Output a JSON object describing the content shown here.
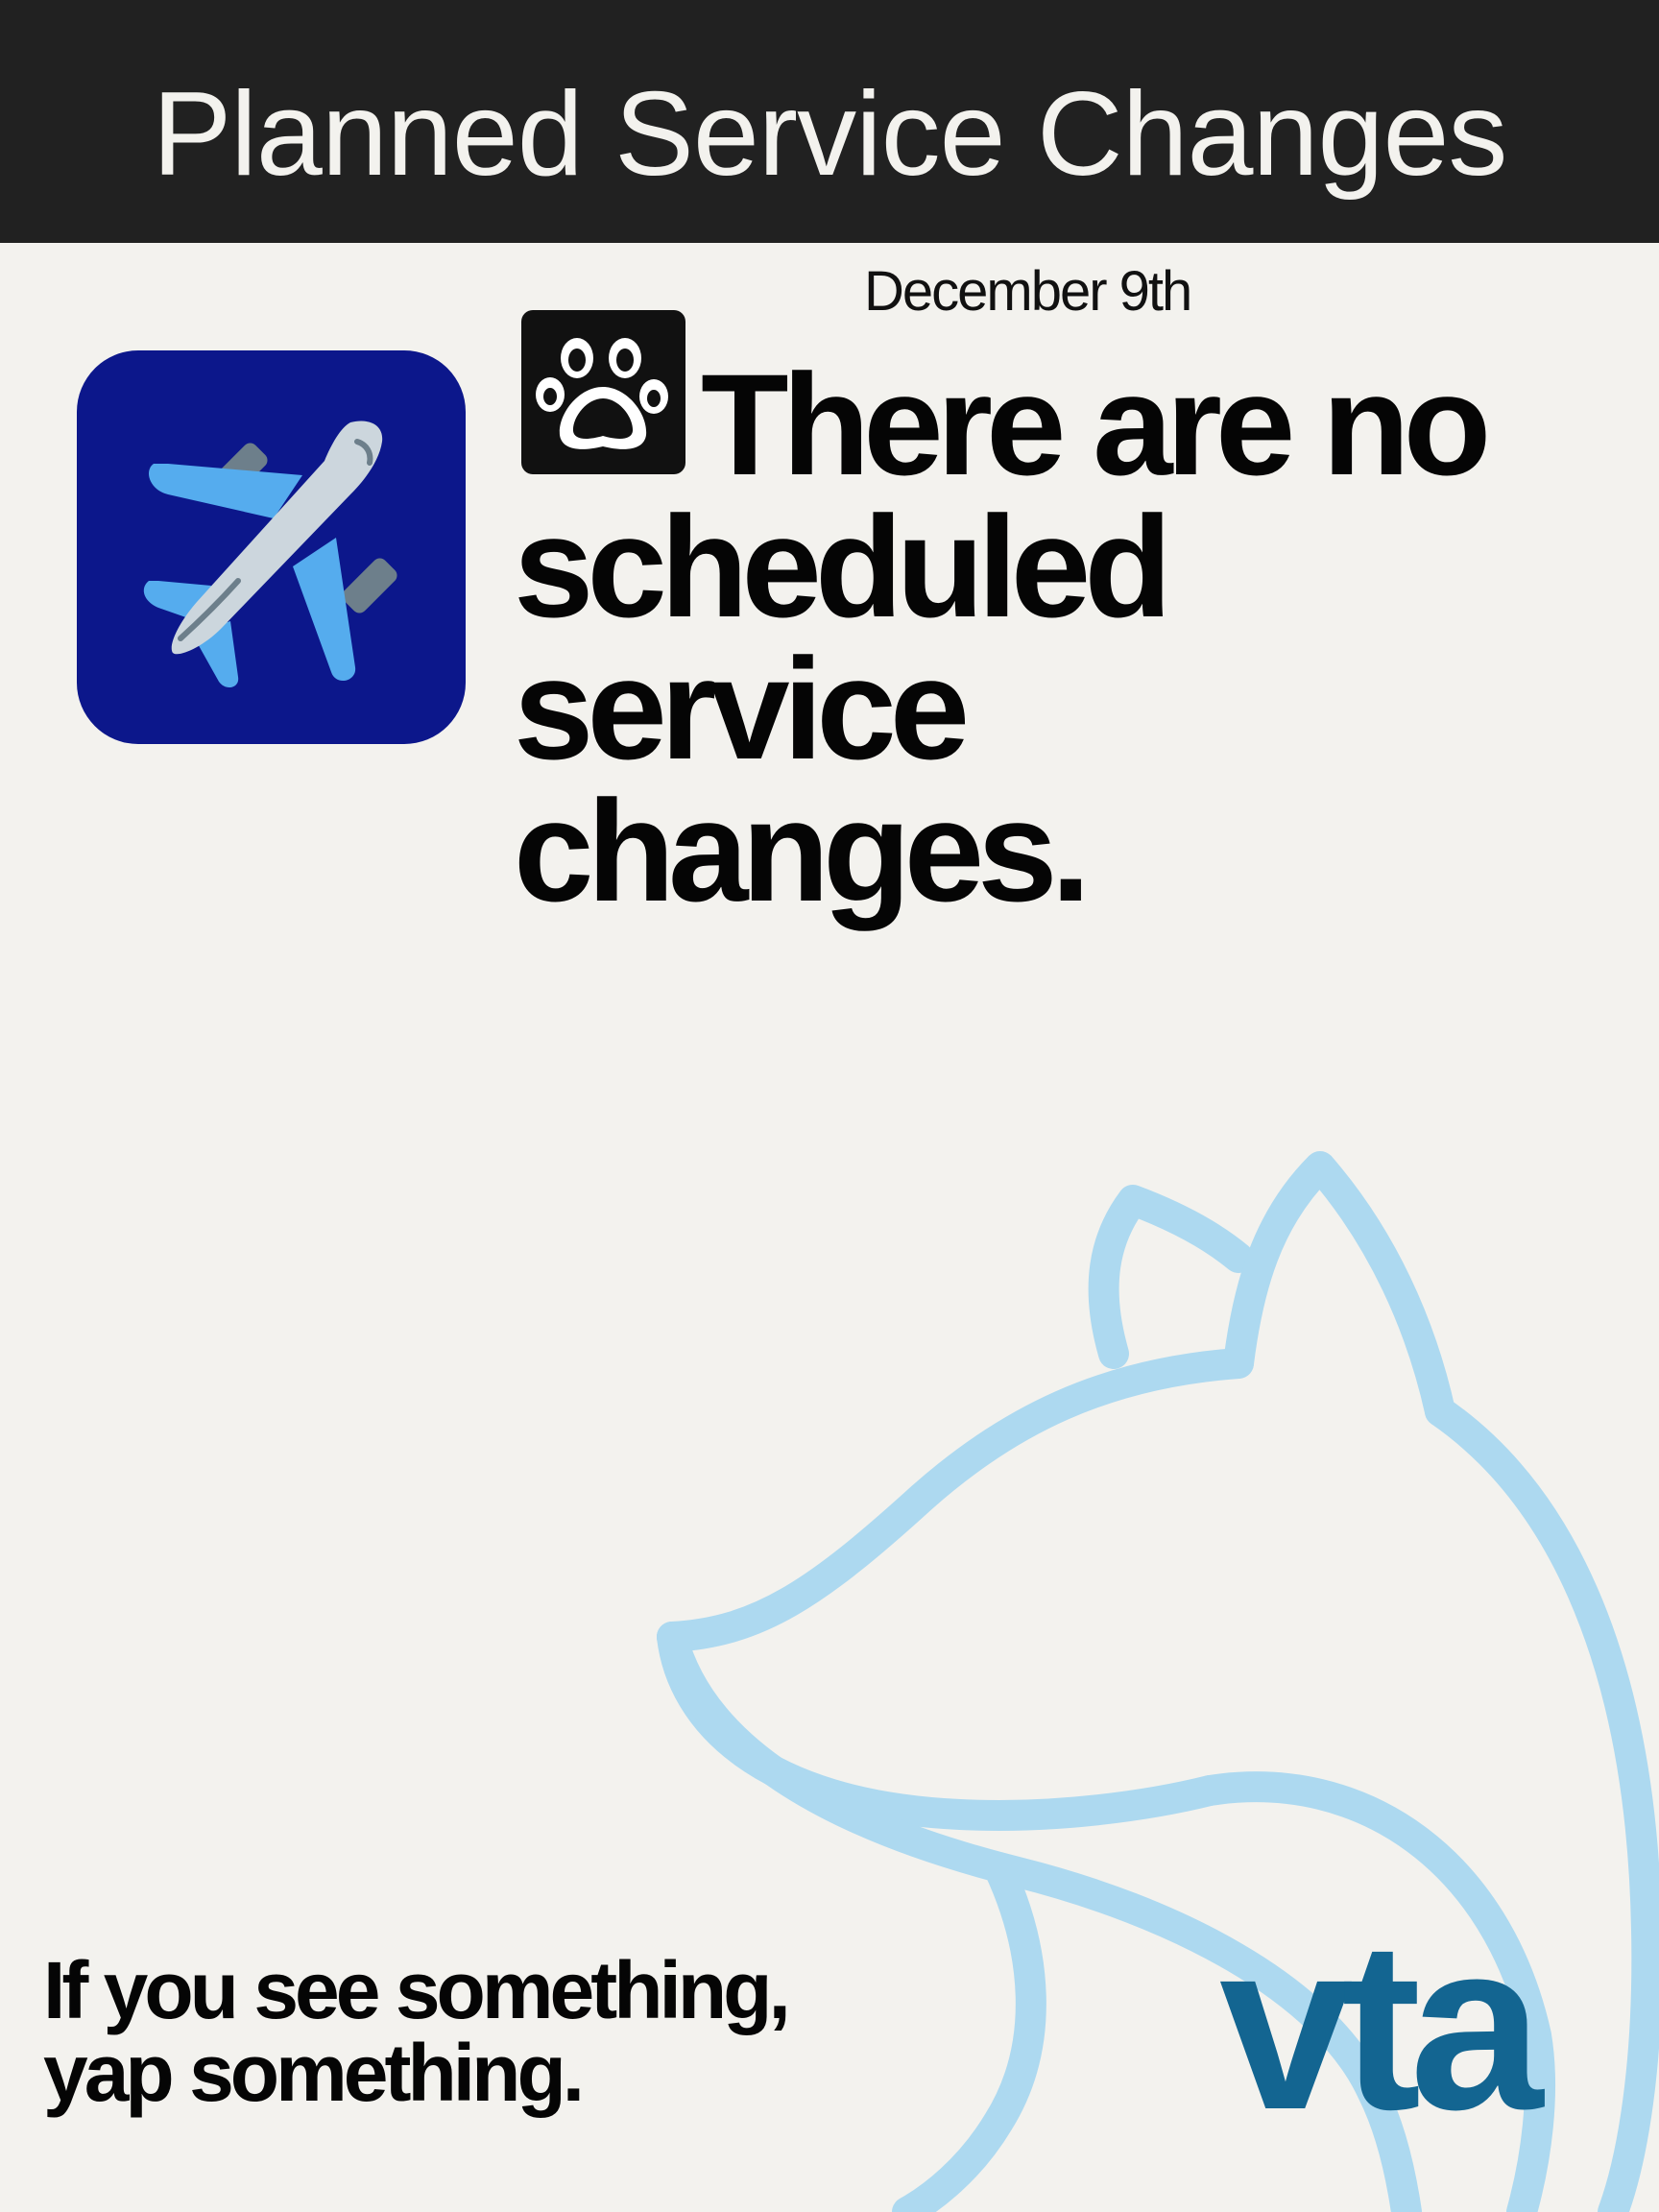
{
  "header": {
    "title": "Planned Service Changes"
  },
  "notice": {
    "date": "December 9th",
    "headline_line1": "There are no",
    "headline_line2": "scheduled service",
    "headline_line3": "changes."
  },
  "icons": {
    "app_tile": "airplane-icon",
    "headline_badge": "paw-print-icon",
    "background_art": "fox-outline"
  },
  "footer": {
    "slogan_line1": "If you see something,",
    "slogan_line2": "yap something.",
    "logo_text": "vta"
  },
  "colors": {
    "header_bg": "#212121",
    "page_bg": "#f3f2ee",
    "app_tile_bg": "#0c178b",
    "fox_outline": "#add9f0",
    "logo": "#136591"
  }
}
